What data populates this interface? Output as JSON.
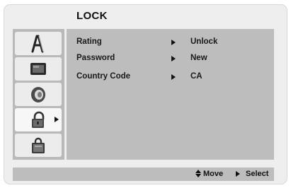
{
  "menu": {
    "title": "LOCK"
  },
  "sidebar": {
    "tabs": [
      {
        "icon": "general-language-icon",
        "selected": false
      },
      {
        "icon": "display-icon",
        "selected": false
      },
      {
        "icon": "audio-speaker-icon",
        "selected": false
      },
      {
        "icon": "lock-icon",
        "selected": true
      },
      {
        "icon": "others-icon",
        "selected": false
      }
    ]
  },
  "settings": [
    {
      "label": "Rating",
      "value": "Unlock"
    },
    {
      "label": "Password",
      "value": "New"
    },
    {
      "label": "Country Code",
      "value": "CA"
    }
  ],
  "footer": {
    "move_label": "Move",
    "select_label": "Select"
  },
  "colors": {
    "panel_bg": "#bdbdbd",
    "frame_bg": "#eeeeee",
    "text": "#111111"
  }
}
